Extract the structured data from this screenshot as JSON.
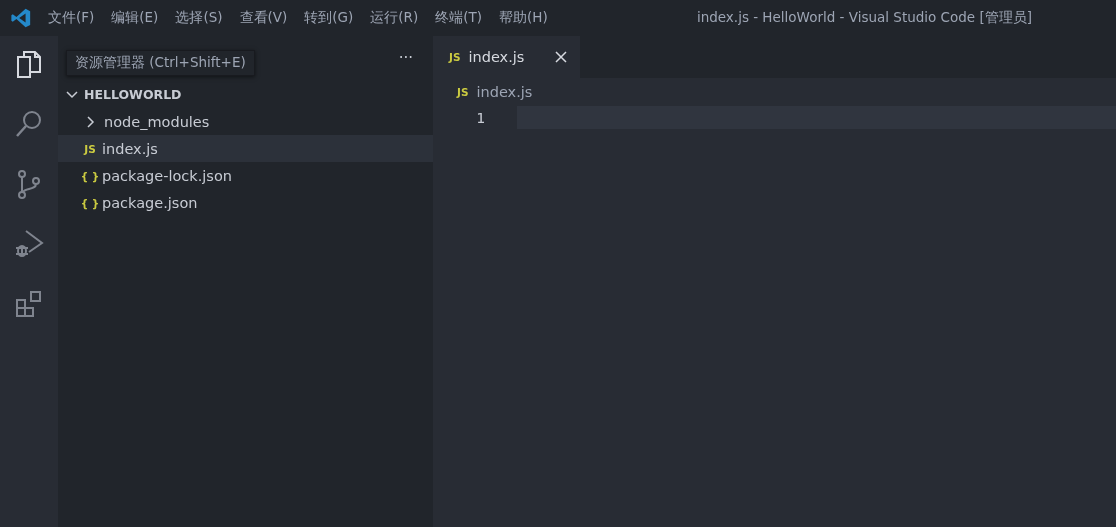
{
  "window": {
    "title": "index.js - HelloWorld - Visual Studio Code [管理员]"
  },
  "menu": [
    "文件(F)",
    "编辑(E)",
    "选择(S)",
    "查看(V)",
    "转到(G)",
    "运行(R)",
    "终端(T)",
    "帮助(H)"
  ],
  "activity_bar": [
    {
      "kind": "explorer",
      "selected": true
    },
    {
      "kind": "search",
      "selected": false
    },
    {
      "kind": "source-control",
      "selected": false
    },
    {
      "kind": "run-debug",
      "selected": false
    },
    {
      "kind": "extensions",
      "selected": false
    }
  ],
  "tooltip": "资源管理器 (Ctrl+Shift+E)",
  "sidebar": {
    "more": "···",
    "folder": {
      "name": "HELLOWORLD",
      "expanded": true,
      "children": [
        {
          "name": "node_modules",
          "kind": "folder",
          "expanded": false,
          "selected": false
        },
        {
          "name": "index.js",
          "kind": "file",
          "icon": "JS",
          "selected": true
        },
        {
          "name": "package-lock.json",
          "kind": "file",
          "icon": "{ }",
          "selected": false
        },
        {
          "name": "package.json",
          "kind": "file",
          "icon": "{ }",
          "selected": false
        }
      ]
    }
  },
  "tabs": [
    {
      "label": "index.js",
      "icon": "JS",
      "selected": true
    }
  ],
  "breadcrumb": {
    "icon": "JS",
    "label": "index.js"
  },
  "editor": {
    "lines": [
      {
        "number": "1"
      }
    ]
  }
}
